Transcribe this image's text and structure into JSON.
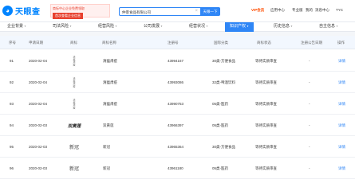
{
  "header": {
    "logo_text": "天眼查",
    "banner_line1": "商标中心企业免费领取",
    "banner_line2": "首次查看企业信息",
    "search_value": "仲景食品有限公司",
    "search_button": "天眼一下",
    "nav_vip": "VIP会员",
    "nav_items": [
      "应用中心",
      "专业版",
      "我的",
      "消息中心",
      "TYC"
    ]
  },
  "tabs": [
    {
      "label": "企业背景",
      "active": false
    },
    {
      "label": "司法风险",
      "active": false
    },
    {
      "label": "经营风险",
      "active": false
    },
    {
      "label": "公司发展",
      "active": false
    },
    {
      "label": "经营状况",
      "active": false
    },
    {
      "label": "知识产权",
      "active": true
    },
    {
      "label": "历史信息",
      "active": false
    },
    {
      "label": "自主信息",
      "active": false
    }
  ],
  "table": {
    "columns": [
      "序号",
      "申请日期",
      "商标",
      "商标名称",
      "注册号",
      "国际分类",
      "商标状态",
      "注册公告日期",
      "操作"
    ],
    "rows": [
      {
        "index": "91",
        "date": "2020-02-04",
        "mark_text": "清瘟肃疫",
        "mark_style": "vertical",
        "name": "清瘟肃疫",
        "reg_no": "43994167",
        "class": "30类-方便食品",
        "status": "等待实质审查",
        "notice": "-",
        "action": "详情"
      },
      {
        "index": "92",
        "date": "2020-02-04",
        "mark_text": "清瘟肃疫",
        "mark_style": "vertical",
        "name": "清瘟肃疫",
        "reg_no": "43993086",
        "class": "32类-啤酒饮料",
        "status": "等待实质审查",
        "notice": "-",
        "action": "详情"
      },
      {
        "index": "93",
        "date": "2020-02-04",
        "mark_text": "清瘟肃疫",
        "mark_style": "vertical",
        "name": "清瘟肃疫",
        "reg_no": "43990753",
        "class": "05类-医药",
        "status": "等待实质审查",
        "notice": "-",
        "action": "详情"
      },
      {
        "index": "94",
        "date": "2020-02-03",
        "mark_text": "双黄莲",
        "mark_style": "cursive",
        "name": "双黄莲",
        "reg_no": "43966397",
        "class": "05类-医药",
        "status": "等待实质审查",
        "notice": "-",
        "action": "详情"
      },
      {
        "index": "95",
        "date": "2020-02-03",
        "mark_text": "新冠",
        "mark_style": "plain",
        "name": "新冠",
        "reg_no": "43965364",
        "class": "30类-方便食品",
        "status": "等待实质审查",
        "notice": "-",
        "action": "详情"
      },
      {
        "index": "96",
        "date": "2020-02-03",
        "mark_text": "新冠",
        "mark_style": "plain",
        "name": "新冠",
        "reg_no": "43961180",
        "class": "05类-医药",
        "status": "等待实质审查",
        "notice": "-",
        "action": "详情"
      }
    ]
  }
}
